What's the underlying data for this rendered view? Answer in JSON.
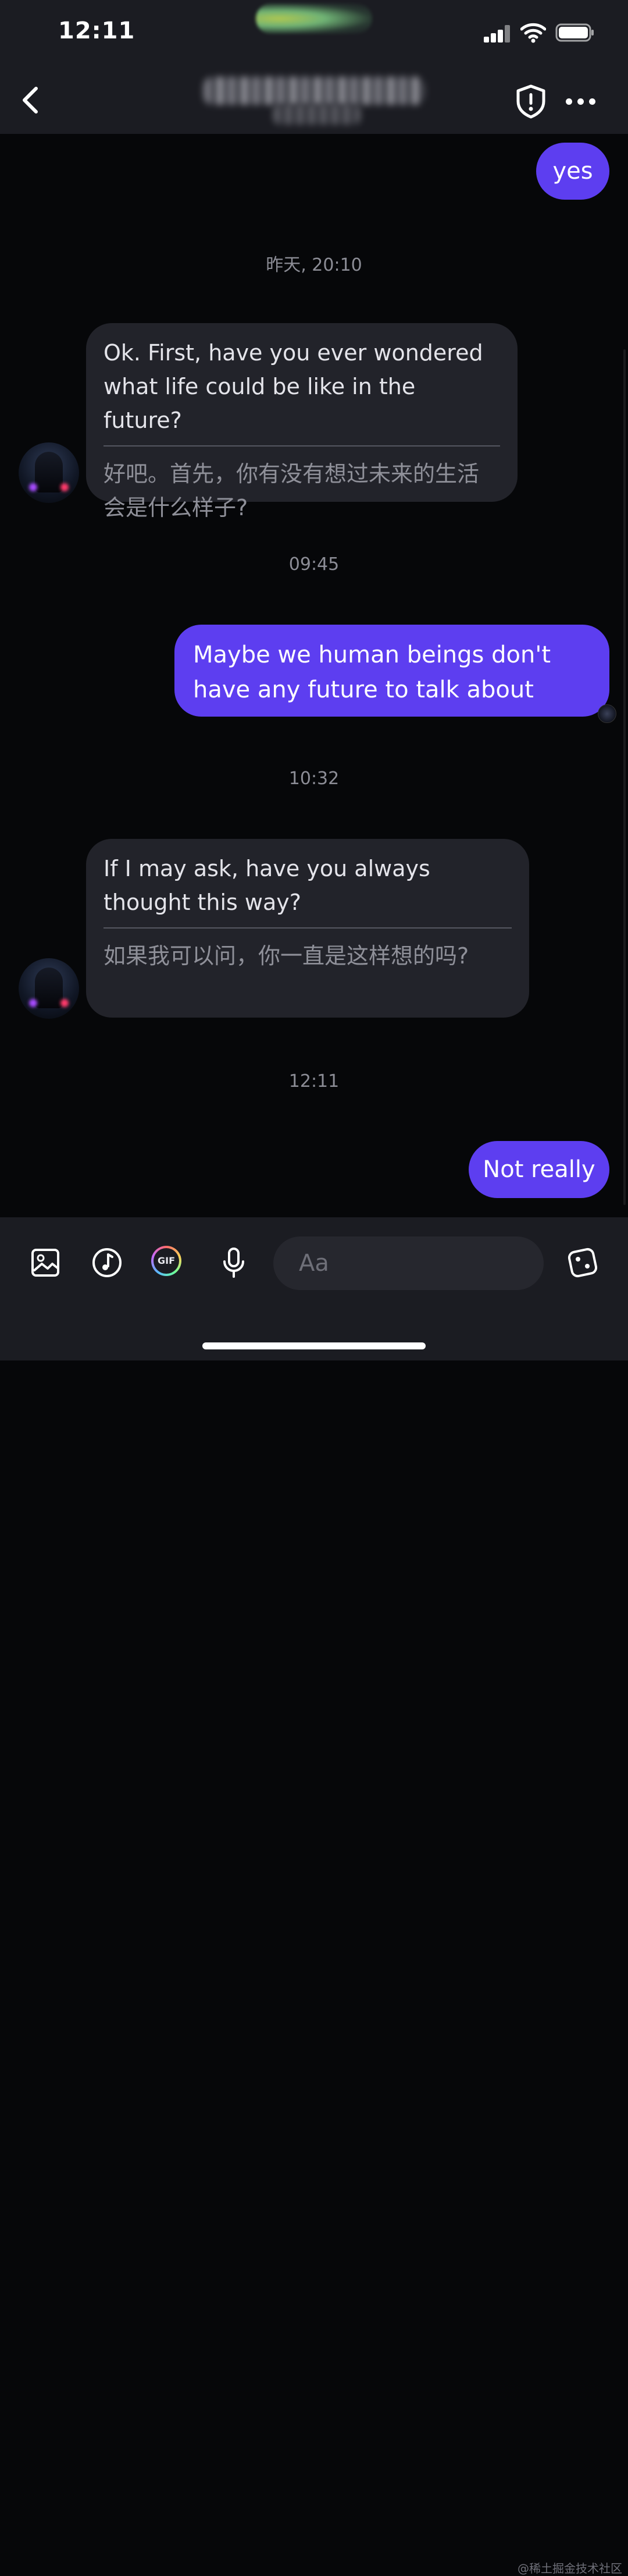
{
  "status_bar": {
    "time": "12:11"
  },
  "header": {
    "title": "",
    "subtitle": ""
  },
  "icons": {
    "back": "chevron-left-icon",
    "shield": "shield-alert-icon",
    "more": "more-horizontal-icon",
    "image": "image-icon",
    "music": "music-note-icon",
    "gif": "gif-icon",
    "mic": "microphone-icon",
    "dice": "dice-icon"
  },
  "colors": {
    "accent": "#5d3ef0",
    "incoming_bubble": "#22232a",
    "background": "#060709"
  },
  "messages": [
    {
      "type": "outgoing",
      "text": "yes"
    },
    {
      "type": "timestamp",
      "text": "昨天, 20:10"
    },
    {
      "type": "incoming",
      "text": "Ok. First, have you ever wondered what life could be like in the future?",
      "translation": "好吧。首先，你有没有想过未来的生活会是什么样子?"
    },
    {
      "type": "timestamp",
      "text": "09:45"
    },
    {
      "type": "outgoing",
      "text": "Maybe we human beings don't have any future to talk about"
    },
    {
      "type": "timestamp",
      "text": "10:32"
    },
    {
      "type": "incoming",
      "text": "If I may ask, have you always thought this way?",
      "translation": "如果我可以问，你一直是这样想的吗?"
    },
    {
      "type": "timestamp",
      "text": "12:11"
    },
    {
      "type": "outgoing",
      "text": "Not really"
    }
  ],
  "composer": {
    "placeholder": "Aa",
    "gif_label": "GIF"
  },
  "watermark": "@稀土掘金技术社区"
}
